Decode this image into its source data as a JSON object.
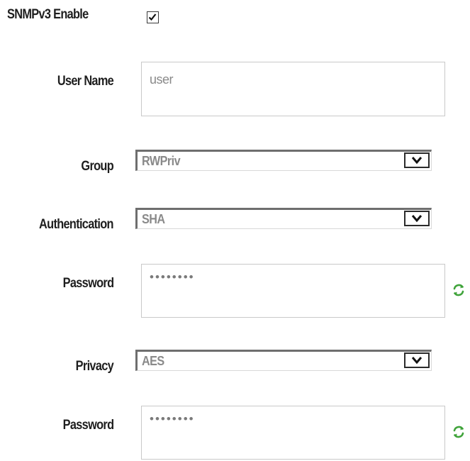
{
  "snmpv3": {
    "enable_label": "SNMPv3 Enable",
    "enabled": true
  },
  "user_name": {
    "label": "User Name",
    "value": "user"
  },
  "group": {
    "label": "Group",
    "selected": "RWPriv"
  },
  "authentication": {
    "label": "Authentication",
    "selected": "SHA",
    "password_label": "Password",
    "password_mask": "••••••••",
    "refresh_icon": "refresh-icon"
  },
  "privacy": {
    "label": "Privacy",
    "selected": "AES",
    "password_label": "Password",
    "password_mask": "••••••••",
    "refresh_icon": "refresh-icon"
  },
  "colors": {
    "refresh_green": "#3fa33a",
    "field_border": "#c9c9c9",
    "value_text": "#8a8a8a"
  }
}
